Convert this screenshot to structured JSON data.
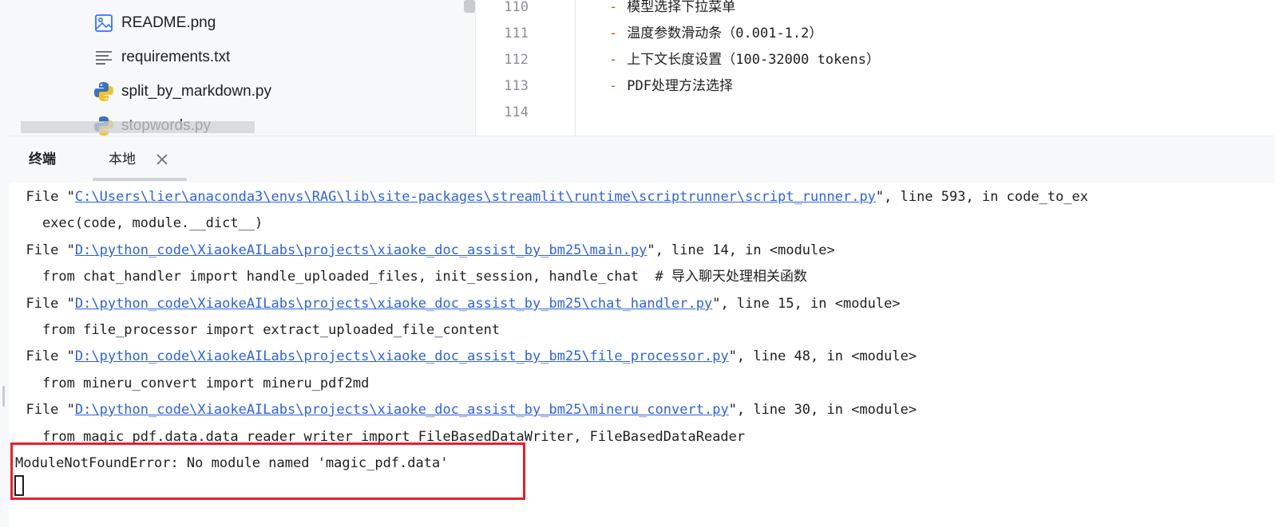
{
  "project_tree": {
    "files": [
      {
        "name": "README.png",
        "icon": "image-icon"
      },
      {
        "name": "requirements.txt",
        "icon": "text-file-icon"
      },
      {
        "name": "split_by_markdown.py",
        "icon": "python-icon"
      },
      {
        "name": "stopwords.py",
        "icon": "python-icon"
      }
    ]
  },
  "editor": {
    "lines": [
      {
        "number": "110",
        "text": "模型选择下拉菜单"
      },
      {
        "number": "111",
        "text": "温度参数滑动条（0.001-1.2）"
      },
      {
        "number": "112",
        "text": "上下文长度设置（100-32000 tokens）"
      },
      {
        "number": "113",
        "text": "PDF处理方法选择"
      },
      {
        "number": "114",
        "text": ""
      }
    ],
    "bullet": "-"
  },
  "terminal": {
    "title": "终端",
    "tab_label": "本地",
    "lines": [
      {
        "prefix": "  File \"",
        "link": "C:\\Users\\lier\\anaconda3\\envs\\RAG\\lib\\site-packages\\streamlit\\runtime\\scriptrunner\\script_runner.py",
        "suffix": "\", line 593, in code_to_ex"
      },
      {
        "prefix": "    exec(code, module.__dict__)",
        "link": "",
        "suffix": ""
      },
      {
        "prefix": "  File \"",
        "link": "D:\\python_code\\XiaokeAILabs\\projects\\xiaoke_doc_assist_by_bm25\\main.py",
        "suffix": "\", line 14, in <module>"
      },
      {
        "prefix": "    from chat_handler import handle_uploaded_files, init_session, handle_chat  # 导入聊天处理相关函数",
        "link": "",
        "suffix": ""
      },
      {
        "prefix": "  File \"",
        "link": "D:\\python_code\\XiaokeAILabs\\projects\\xiaoke_doc_assist_by_bm25\\chat_handler.py",
        "suffix": "\", line 15, in <module>"
      },
      {
        "prefix": "    from file_processor import extract_uploaded_file_content",
        "link": "",
        "suffix": ""
      },
      {
        "prefix": "  File \"",
        "link": "D:\\python_code\\XiaokeAILabs\\projects\\xiaoke_doc_assist_by_bm25\\file_processor.py",
        "suffix": "\", line 48, in <module>"
      },
      {
        "prefix": "    from mineru_convert import mineru_pdf2md",
        "link": "",
        "suffix": ""
      },
      {
        "prefix": "  File \"",
        "link": "D:\\python_code\\XiaokeAILabs\\projects\\xiaoke_doc_assist_by_bm25\\mineru_convert.py",
        "suffix": "\", line 30, in <module>"
      },
      {
        "prefix": "    from magic_pdf.data.data_reader_writer import FileBasedDataWriter, FileBasedDataReader",
        "link": "",
        "suffix": ""
      },
      {
        "prefix": "ModuleNotFoundError: No module named 'magic_pdf.data'",
        "link": "",
        "suffix": ""
      }
    ]
  },
  "colors": {
    "link": "#2f63d9",
    "highlight_border": "#e8202a",
    "bullet": "#c85a1a"
  }
}
